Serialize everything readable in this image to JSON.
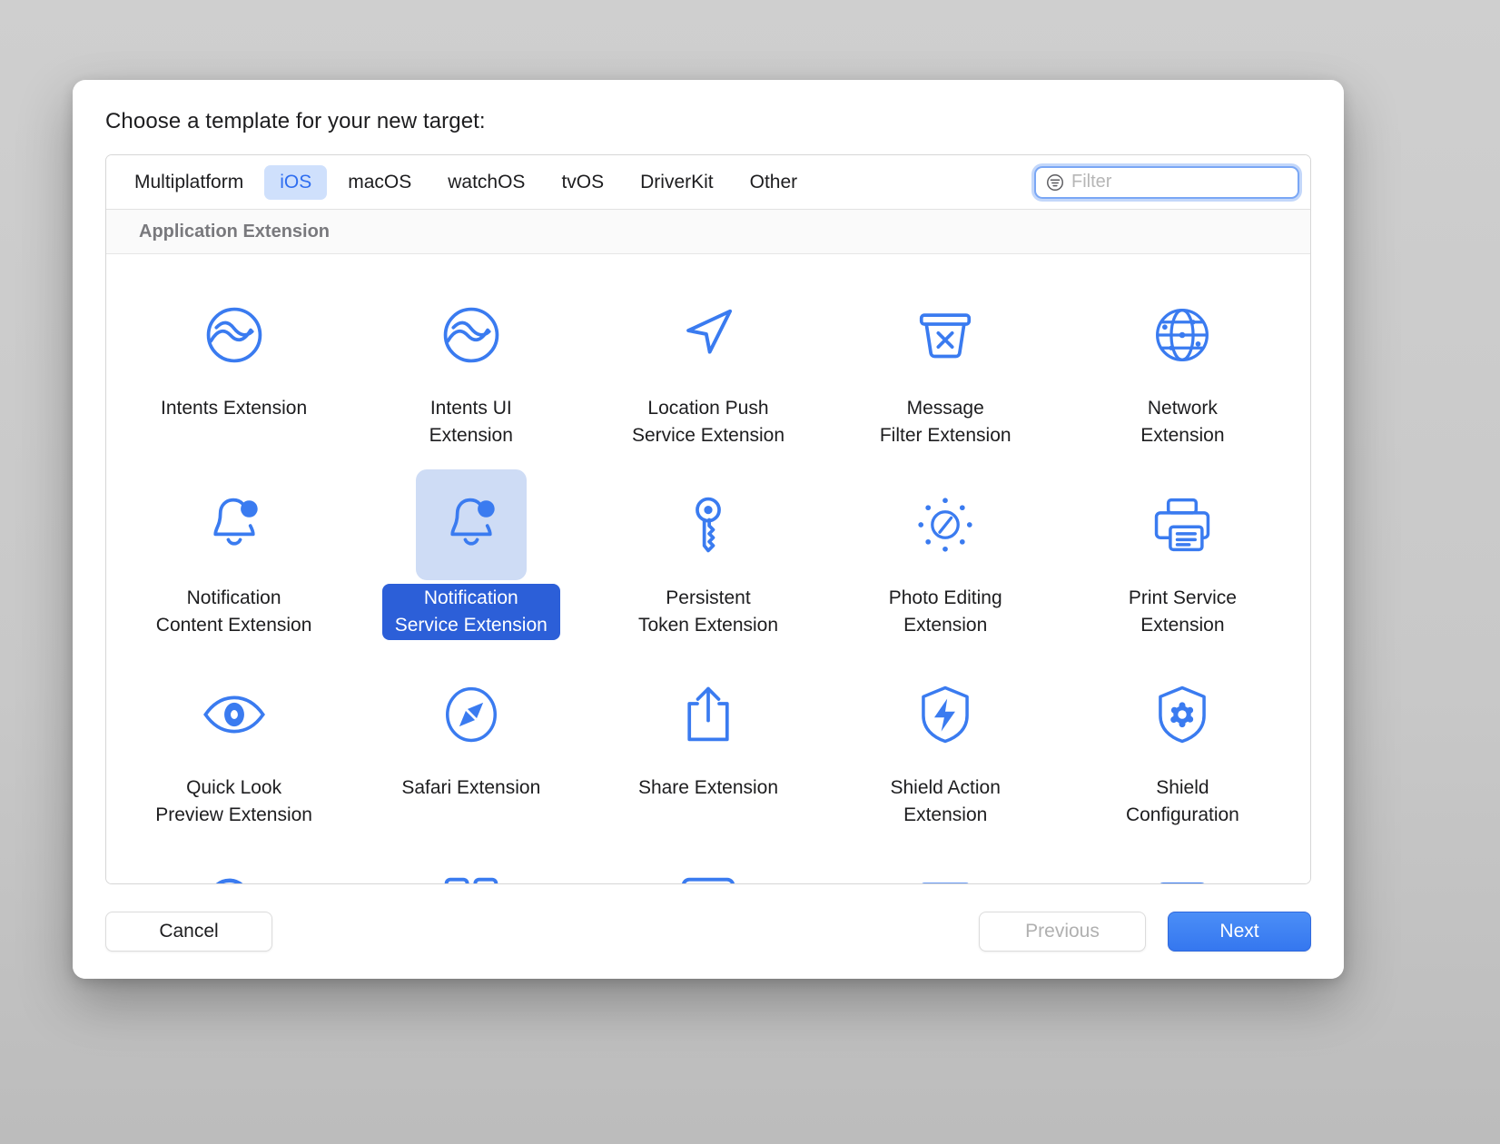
{
  "dialog": {
    "title": "Choose a template for your new target:"
  },
  "tabs": [
    {
      "label": "Multiplatform",
      "active": false
    },
    {
      "label": "iOS",
      "active": true
    },
    {
      "label": "macOS",
      "active": false
    },
    {
      "label": "watchOS",
      "active": false
    },
    {
      "label": "tvOS",
      "active": false
    },
    {
      "label": "DriverKit",
      "active": false
    },
    {
      "label": "Other",
      "active": false
    }
  ],
  "filter": {
    "icon": "filter-list-icon",
    "value": "",
    "placeholder": "Filter"
  },
  "section": {
    "header": "Application Extension"
  },
  "templates": [
    {
      "label": "Intents Extension",
      "icon": "intents-icon",
      "selected": false
    },
    {
      "label": "Intents UI\nExtension",
      "icon": "intents-ui-icon",
      "selected": false
    },
    {
      "label": "Location Push\nService Extension",
      "icon": "location-arrow-icon",
      "selected": false
    },
    {
      "label": "Message\nFilter Extension",
      "icon": "basket-x-icon",
      "selected": false
    },
    {
      "label": "Network\nExtension",
      "icon": "globe-icon",
      "selected": false
    },
    {
      "label": "Notification\nContent Extension",
      "icon": "bell-badge-icon",
      "selected": false
    },
    {
      "label": "Notification\nService Extension",
      "icon": "bell-badge-icon",
      "selected": true
    },
    {
      "label": "Persistent\nToken Extension",
      "icon": "key-icon",
      "selected": false
    },
    {
      "label": "Photo Editing\nExtension",
      "icon": "brightness-icon",
      "selected": false
    },
    {
      "label": "Print Service\nExtension",
      "icon": "printer-icon",
      "selected": false
    },
    {
      "label": "Quick Look\nPreview Extension",
      "icon": "eye-icon",
      "selected": false
    },
    {
      "label": "Safari Extension",
      "icon": "compass-icon",
      "selected": false
    },
    {
      "label": "Share Extension",
      "icon": "share-icon",
      "selected": false
    },
    {
      "label": "Shield Action\nExtension",
      "icon": "shield-bolt-icon",
      "selected": false
    },
    {
      "label": "Shield\nConfiguration",
      "icon": "shield-gear-icon",
      "selected": false
    },
    {
      "label": "",
      "icon": "magnifier-icon",
      "selected": false
    },
    {
      "label": "",
      "icon": "grid-squares-icon",
      "selected": false
    },
    {
      "label": "",
      "icon": "panel-corner-icon",
      "selected": false
    },
    {
      "label": "",
      "icon": "basket-x-icon",
      "selected": false
    },
    {
      "label": "",
      "icon": "calendar-icon",
      "selected": false
    }
  ],
  "footer": {
    "cancel": "Cancel",
    "previous": "Previous",
    "next": "Next"
  },
  "colors": {
    "accent": "#3a7bf0",
    "selection": "#2c5fd8",
    "selection_icon_bg": "#cedcf5",
    "tab_active_bg": "#cfe0fc",
    "tab_active_text": "#2f6ef0"
  }
}
